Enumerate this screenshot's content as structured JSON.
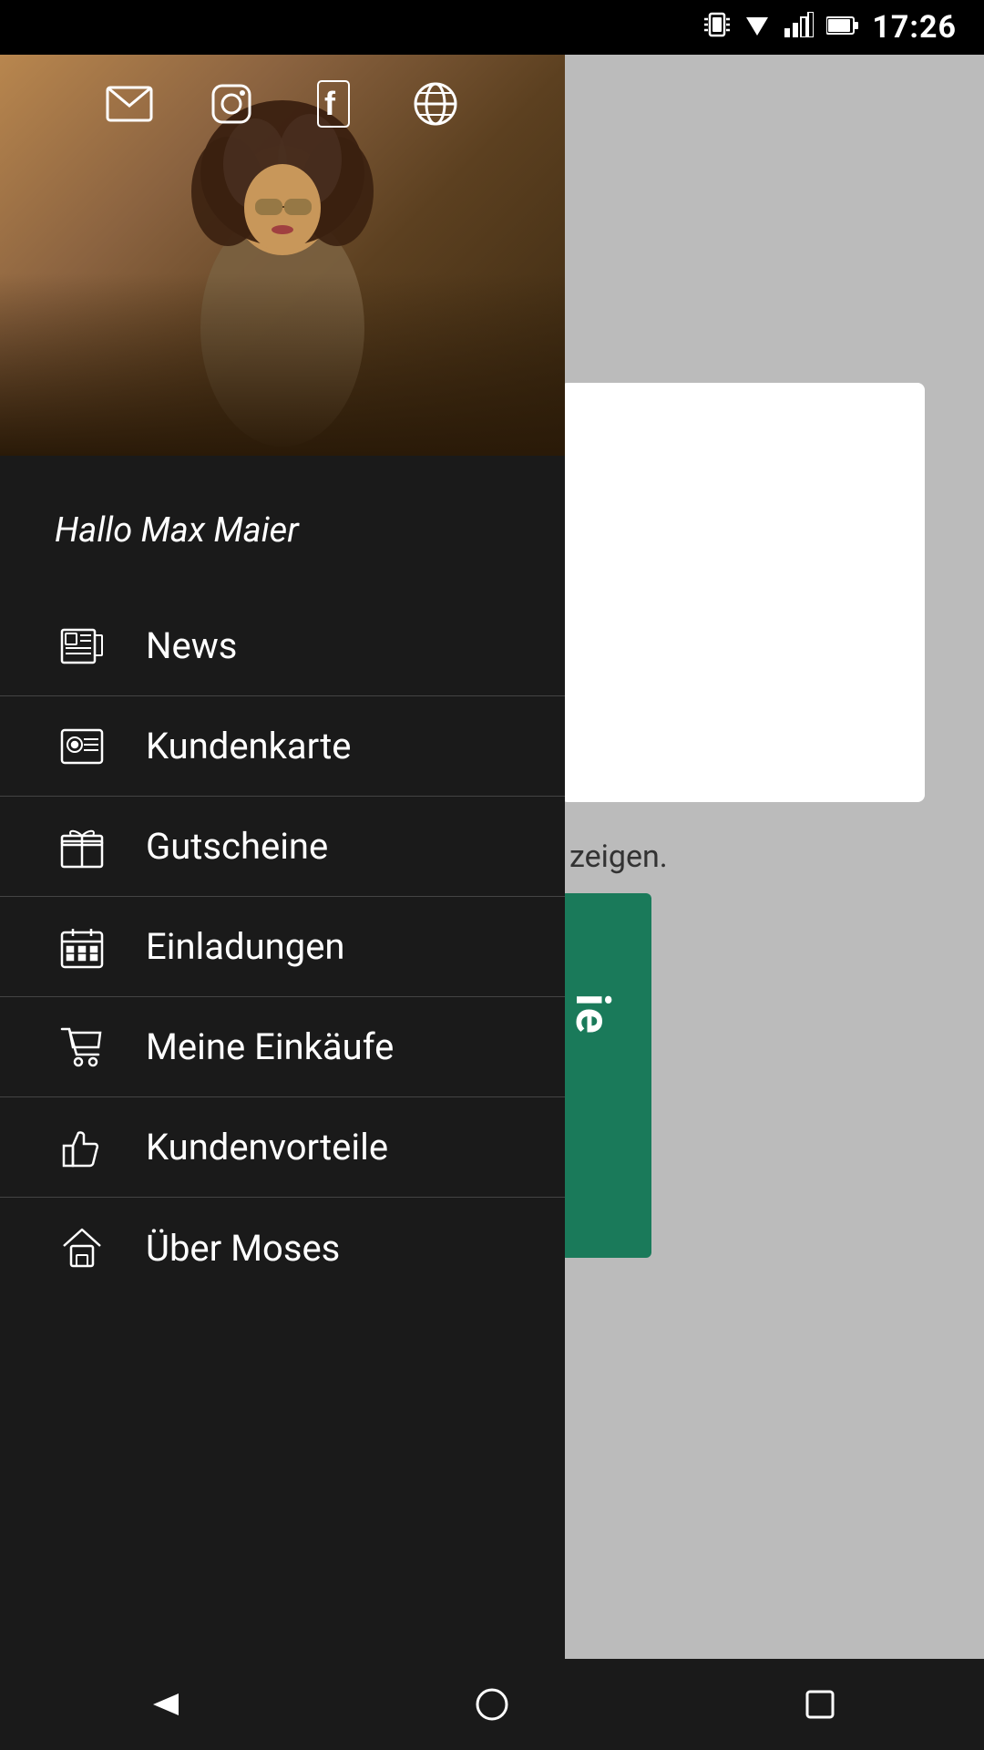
{
  "statusBar": {
    "time": "17:26",
    "icons": [
      "vibrate",
      "wifi",
      "signal",
      "battery"
    ]
  },
  "drawer": {
    "greeting": "Hallo Max Maier",
    "socialIcons": [
      {
        "name": "email",
        "symbol": "✉"
      },
      {
        "name": "instagram",
        "symbol": "◉"
      },
      {
        "name": "facebook",
        "symbol": "f"
      },
      {
        "name": "web",
        "symbol": "⊕"
      }
    ],
    "menuItems": [
      {
        "id": "news",
        "label": "News",
        "icon": "newspaper"
      },
      {
        "id": "kundenkarte",
        "label": "Kundenkarte",
        "icon": "card"
      },
      {
        "id": "gutscheine",
        "label": "Gutscheine",
        "icon": "gift"
      },
      {
        "id": "einladungen",
        "label": "Einladungen",
        "icon": "calendar"
      },
      {
        "id": "meine-einkaeufe",
        "label": "Meine Einkäufe",
        "icon": "cart"
      },
      {
        "id": "kundenvorteile",
        "label": "Kundenvorteile",
        "icon": "thumbsup"
      },
      {
        "id": "uber-moses",
        "label": "Über Moses",
        "icon": "home"
      }
    ]
  },
  "background": {
    "partialText": "zeigen.",
    "greenButtonText": "ie"
  },
  "bottomNav": {
    "back": "◁",
    "home": "○",
    "recent": "□"
  }
}
